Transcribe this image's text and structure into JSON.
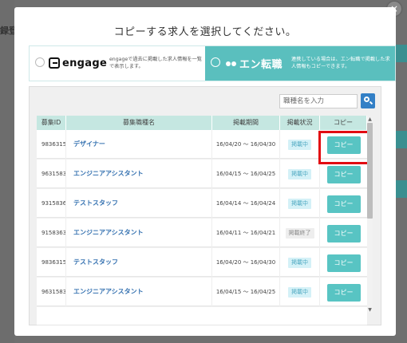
{
  "background": {
    "side_text": "録登"
  },
  "modal": {
    "title": "コピーする求人を選択してください。",
    "close_label": "×"
  },
  "sources": [
    {
      "logo_text": "engage",
      "description": "engageで過去に掲載した求人情報を一覧で表示します。",
      "selected": false
    },
    {
      "logo_text": "エン転職",
      "description": "連携している場合は、エン転職で掲載した求人情報もコピーできます。",
      "selected": true
    }
  ],
  "search": {
    "placeholder": "職種名を入力"
  },
  "table": {
    "headers": {
      "id": "募集ID",
      "name": "募集職種名",
      "period": "掲載期間",
      "status": "掲載状況",
      "copy": "コピー"
    },
    "rows": [
      {
        "id": "9836315",
        "name": "デザイナー",
        "period": "16/04/20 ～ 16/04/30",
        "status": "掲載中",
        "status_type": "active",
        "copy": "コピー"
      },
      {
        "id": "9631583",
        "name": "エンジニアアシスタント",
        "period": "16/04/15 ～ 16/04/25",
        "status": "掲載中",
        "status_type": "active",
        "copy": "コピー"
      },
      {
        "id": "9315836",
        "name": "テストスタッフ",
        "period": "16/04/14 ～ 16/04/24",
        "status": "掲載中",
        "status_type": "active",
        "copy": "コピー"
      },
      {
        "id": "9158363",
        "name": "エンジニアアシスタント",
        "period": "16/04/11 ～ 16/04/21",
        "status": "掲載終了",
        "status_type": "ended",
        "copy": "コピー"
      },
      {
        "id": "9836315",
        "name": "テストスタッフ",
        "period": "16/04/20 ～ 16/04/30",
        "status": "掲載中",
        "status_type": "active",
        "copy": "コピー"
      },
      {
        "id": "9631583",
        "name": "エンジニアアシスタント",
        "period": "16/04/15 ～ 16/04/25",
        "status": "掲載中",
        "status_type": "active",
        "copy": "コピー"
      }
    ]
  },
  "colors": {
    "accent": "#58c4c3",
    "link": "#3471b0",
    "highlight": "#e20b12",
    "search_button": "#3380c6"
  },
  "icons": {
    "close": "close-icon",
    "search": "search-icon",
    "engage_logo": "engage-logo-icon",
    "en_logo": "en-tenshoku-logo-icon"
  }
}
